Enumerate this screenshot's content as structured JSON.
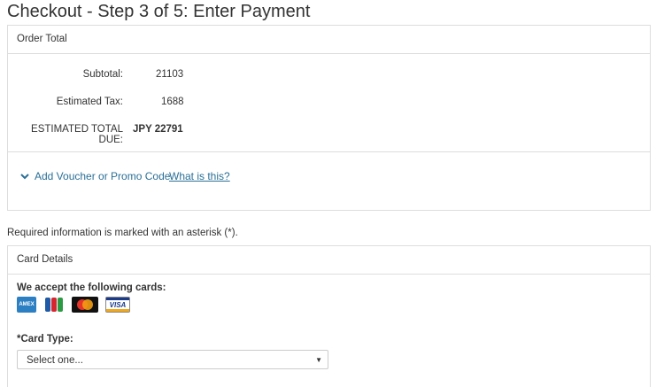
{
  "page": {
    "title": "Checkout - Step 3 of 5: Enter Payment"
  },
  "order_total": {
    "heading": "Order Total",
    "subtotal_label": "Subtotal:",
    "subtotal_value": "21103",
    "tax_label": "Estimated Tax:",
    "tax_value": "1688",
    "total_label": "ESTIMATED TOTAL DUE:",
    "total_value": "JPY 22791",
    "voucher_link": "Add Voucher or Promo Code",
    "what_is_this": "What is this?"
  },
  "required_note": "Required information is marked with an asterisk (*).",
  "card_details": {
    "heading": "Card Details",
    "accept_label": "We accept the following cards:",
    "cards": [
      {
        "name": "amex-icon",
        "text": "AMEX"
      },
      {
        "name": "jcb-icon",
        "text": ""
      },
      {
        "name": "mastercard-icon",
        "text": ""
      },
      {
        "name": "visa-icon",
        "text": "VISA"
      }
    ],
    "card_type_label": "*Card Type:",
    "card_type_selected": "Select one..."
  },
  "colors": {
    "link": "#2a6f97",
    "border": "#dddddd"
  }
}
